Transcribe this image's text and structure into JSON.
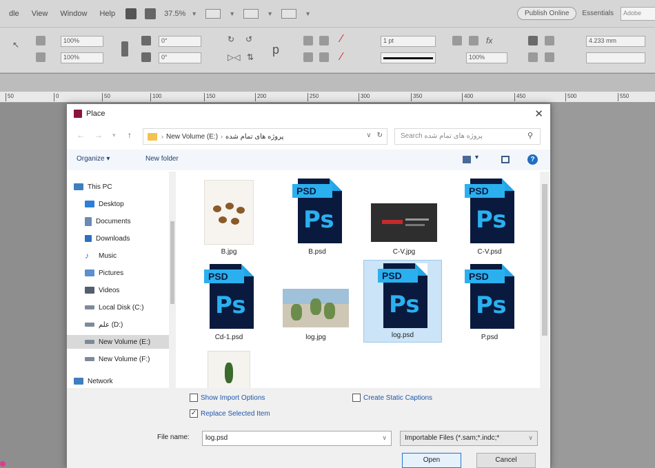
{
  "menubar": {
    "items": [
      "dle",
      "View",
      "Window",
      "Help"
    ],
    "zoom": "37.5%",
    "publish_label": "Publish Online",
    "workspace": "Essentials",
    "search_placeholder": "Adobe"
  },
  "control": {
    "scale_w": "100%",
    "scale_h": "100%",
    "ref_x": "0°",
    "ref_y": "0°",
    "stroke": "1 pt",
    "opacity": "100%",
    "width": "4.233 mm"
  },
  "ruler": {
    "ticks": [
      "50",
      "0",
      "50",
      "100",
      "150",
      "200",
      "250",
      "300",
      "350",
      "400",
      "450",
      "500",
      "550"
    ]
  },
  "dialog": {
    "title": "Place",
    "address": {
      "crumbs": [
        "New Volume (E:)",
        "پروژه های تمام شده"
      ],
      "refresh": "↻"
    },
    "search_placeholder": "Search پروژه های تمام شده",
    "organize_label": "Organize",
    "new_folder_label": "New folder",
    "nav": [
      {
        "label": "This PC",
        "color": "#3f7fbf"
      },
      {
        "label": "Desktop",
        "color": "#2d7fd3"
      },
      {
        "label": "Documents",
        "color": "#6c8bb3"
      },
      {
        "label": "Downloads",
        "color": "#2d6fc0"
      },
      {
        "label": "Music",
        "color": "#3a73c8"
      },
      {
        "label": "Pictures",
        "color": "#5c8ed0"
      },
      {
        "label": "Videos",
        "color": "#555e6e"
      },
      {
        "label": "Local Disk (C:)",
        "color": "#7f8a99"
      },
      {
        "label": "علم (D:)",
        "color": "#7f8a99"
      },
      {
        "label": "New Volume (E:)",
        "color": "#7f8a99"
      },
      {
        "label": "New Volume (F:)",
        "color": "#7f8a99"
      },
      {
        "label": "Network",
        "color": "#3f7fbf"
      }
    ],
    "files": [
      {
        "name": "B.jpg",
        "kind": "food"
      },
      {
        "name": "B.psd",
        "kind": "psd"
      },
      {
        "name": "C-V.jpg",
        "kind": "cv"
      },
      {
        "name": "C-V.psd",
        "kind": "psd"
      },
      {
        "name": "Cd-1.psd",
        "kind": "psd"
      },
      {
        "name": "log.jpg",
        "kind": "street"
      },
      {
        "name": "log.psd",
        "kind": "psd",
        "selected": true
      },
      {
        "name": "P.psd",
        "kind": "psd"
      },
      {
        "name": "",
        "kind": "plant"
      }
    ],
    "psd_tag": "PSD",
    "ps_glyph": "Ps",
    "show_import_options": "Show Import Options",
    "replace_selected": "Replace Selected Item",
    "create_static_captions": "Create Static Captions",
    "replace_checked": "✓",
    "file_name_label": "File name:",
    "file_name_value": "log.psd",
    "file_type_value": "Importable Files (*.sam;*.indc;*",
    "open_label": "Open",
    "cancel_label": "Cancel"
  }
}
